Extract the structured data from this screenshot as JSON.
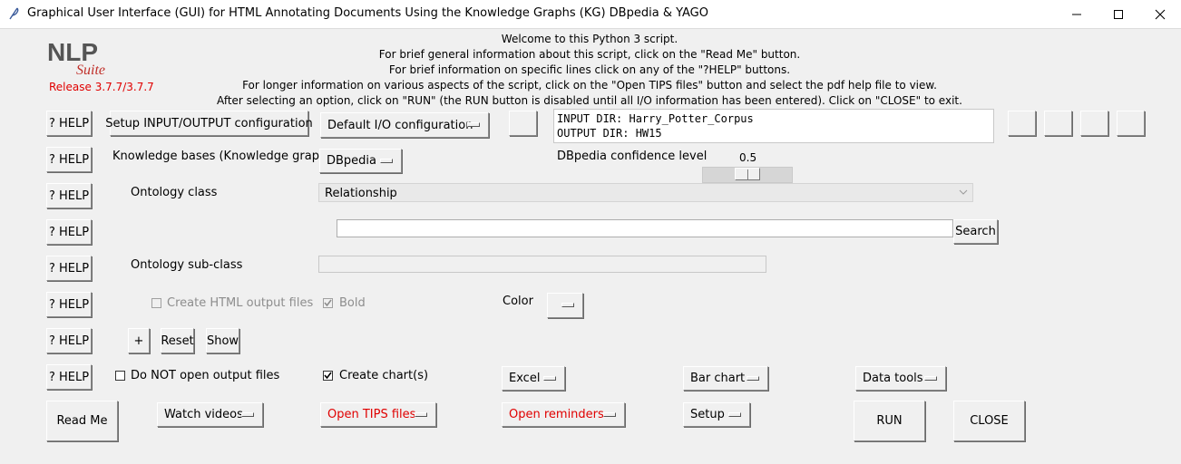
{
  "window": {
    "title": "Graphical User Interface (GUI) for HTML Annotating Documents Using the Knowledge Graphs (KG) DBpedia & YAGO"
  },
  "logo": {
    "nlp": "NLP",
    "suite": "Suite",
    "release": "Release 3.7.7/3.7.7"
  },
  "intro": {
    "line1": "Welcome to this Python 3 script.",
    "line2": "For brief general information about this script, click on the \"Read Me\" button.",
    "line3": "For brief information on specific lines click on any of the \"?HELP\" buttons.",
    "line4": "For longer information on various aspects of the script, click on the \"Open TIPS files\" button and select the pdf help file to view.",
    "line5": "After selecting an option, click on \"RUN\" (the RUN button is disabled until all I/O information has been entered).   Click on \"CLOSE\" to exit."
  },
  "help_label": "? HELP",
  "io": {
    "setup_button": "Setup INPUT/OUTPUT configuration",
    "config_menu": "Default I/O configuration",
    "input_dir": "INPUT DIR: Harry_Potter_Corpus",
    "output_dir": "OUTPUT DIR: HW15"
  },
  "kb": {
    "label": "Knowledge bases (Knowledge graphs)",
    "value": "DBpedia",
    "confidence_label": "DBpedia confidence level",
    "confidence_value": "0.5",
    "confidence_fraction": 0.5
  },
  "ontology": {
    "class_label": "Ontology class",
    "class_value": "Relationship",
    "search_value": "",
    "search_button": "Search",
    "subclass_label": "Ontology sub-class",
    "subclass_value": ""
  },
  "options": {
    "create_html_label": "Create HTML output files",
    "bold_label": "Bold",
    "color_label": "Color",
    "plus_button": "+",
    "reset_button": "Reset",
    "show_button": "Show",
    "no_open_label": "Do NOT open output files",
    "create_charts_label": "Create chart(s)",
    "excel_menu": "Excel",
    "bar_chart_menu": "Bar chart",
    "data_tools_menu": "Data tools"
  },
  "bottom": {
    "read_me": "Read Me",
    "watch_videos": "Watch videos",
    "open_tips": "Open TIPS files",
    "open_reminders": "Open reminders",
    "setup": "Setup",
    "run": "RUN",
    "close": "CLOSE"
  },
  "colors": {
    "red_text": "#e00000",
    "logo_gray": "#555555",
    "logo_red": "#c0302a"
  }
}
